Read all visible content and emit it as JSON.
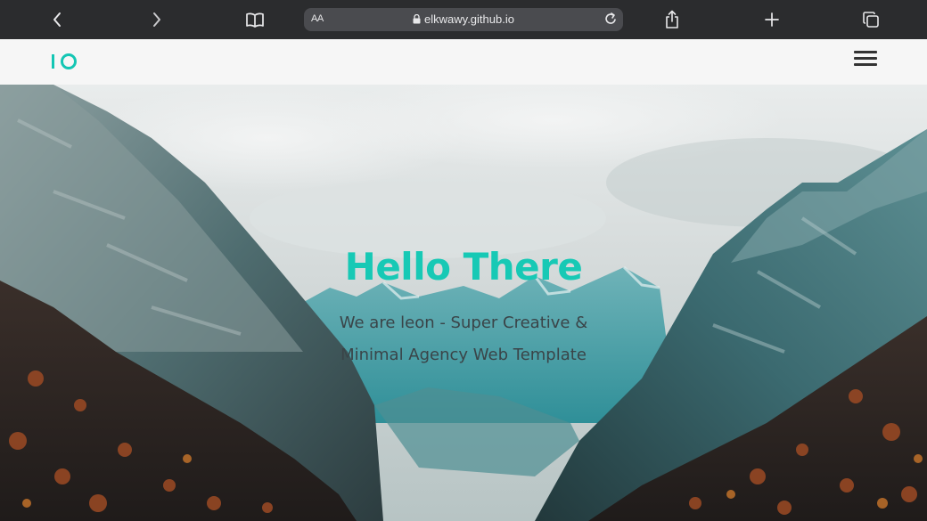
{
  "browser": {
    "text_size_label": "AA",
    "url": "elkwawy.github.io",
    "icons": [
      "back-icon",
      "forward-icon",
      "bookmarks-icon",
      "lock-icon",
      "reload-icon",
      "share-icon",
      "new-tab-icon",
      "tabs-icon"
    ]
  },
  "nav": {
    "logo_text": "IO",
    "menu_icon": "hamburger-icon"
  },
  "hero": {
    "title": "Hello There",
    "subtitle": "We are leon - Super Creative & Minimal Agency Web Template"
  },
  "colors": {
    "accent": "#17c9b5",
    "toolbar": "#2b2c2e",
    "nav_bg": "#f6f6f6"
  }
}
